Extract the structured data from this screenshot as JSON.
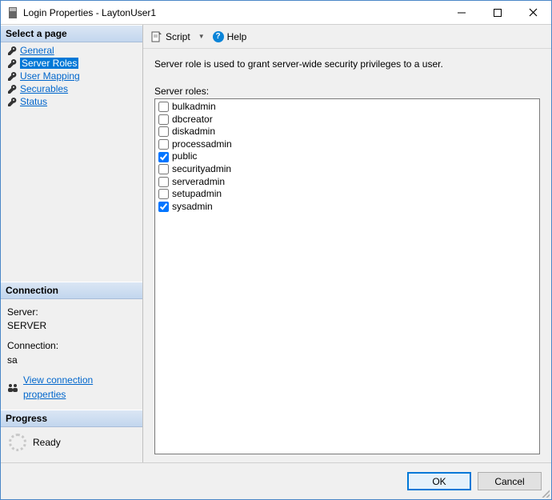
{
  "window": {
    "title": "Login Properties - LaytonUser1"
  },
  "sidebar": {
    "selectPageHeader": "Select a page",
    "pages": [
      {
        "label": "General",
        "selected": false
      },
      {
        "label": "Server Roles",
        "selected": true
      },
      {
        "label": "User Mapping",
        "selected": false
      },
      {
        "label": "Securables",
        "selected": false
      },
      {
        "label": "Status",
        "selected": false
      }
    ],
    "connectionHeader": "Connection",
    "connection": {
      "serverLabel": "Server:",
      "serverValue": "SERVER",
      "connectionLabel": "Connection:",
      "connectionValue": "sa",
      "viewConnLink": "View connection properties"
    },
    "progressHeader": "Progress",
    "progress": {
      "status": "Ready"
    }
  },
  "toolbar": {
    "scriptLabel": "Script",
    "helpLabel": "Help"
  },
  "main": {
    "description": "Server role is used to grant server-wide security privileges to a user.",
    "rolesLabel": "Server roles:",
    "roles": [
      {
        "name": "bulkadmin",
        "checked": false
      },
      {
        "name": "dbcreator",
        "checked": false
      },
      {
        "name": "diskadmin",
        "checked": false
      },
      {
        "name": "processadmin",
        "checked": false
      },
      {
        "name": "public",
        "checked": true
      },
      {
        "name": "securityadmin",
        "checked": false
      },
      {
        "name": "serveradmin",
        "checked": false
      },
      {
        "name": "setupadmin",
        "checked": false
      },
      {
        "name": "sysadmin",
        "checked": true
      }
    ]
  },
  "footer": {
    "okLabel": "OK",
    "cancelLabel": "Cancel"
  }
}
